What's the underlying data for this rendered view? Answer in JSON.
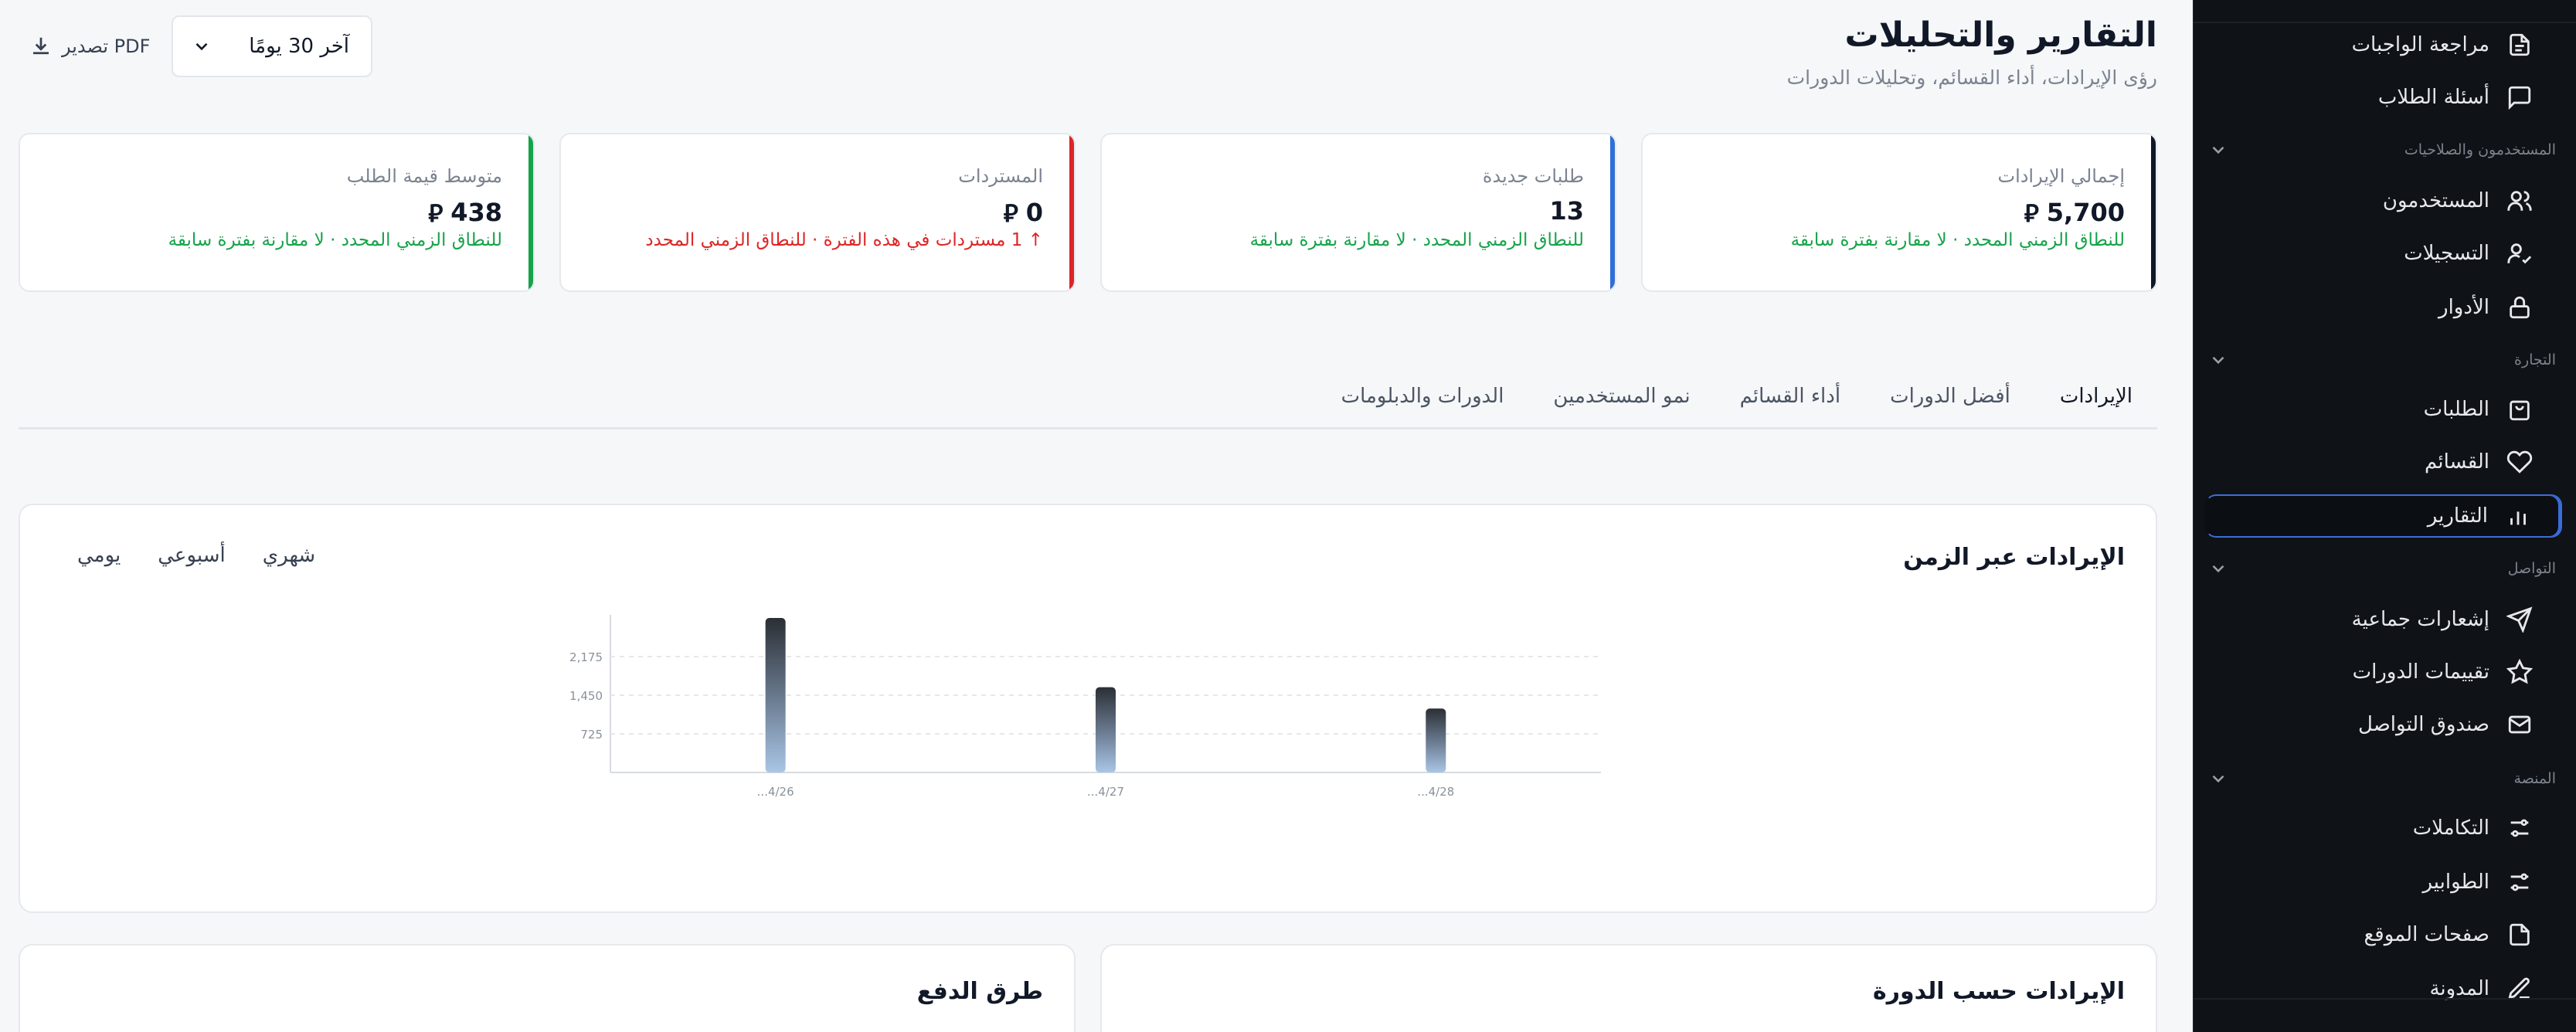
{
  "sidebar": {
    "items": [
      {
        "label": "مراجعة الواجبات",
        "icon": "file-icon"
      },
      {
        "label": "أسئلة الطلاب",
        "icon": "message-icon"
      },
      {
        "label": "المستخدمون",
        "icon": "users-icon"
      },
      {
        "label": "التسجيلات",
        "icon": "user-check-icon"
      },
      {
        "label": "الأدوار",
        "icon": "lock-icon"
      },
      {
        "label": "الطلبات",
        "icon": "shopping-bag-icon"
      },
      {
        "label": "القسائم",
        "icon": "heart-icon"
      },
      {
        "label": "التقارير",
        "icon": "bar-chart-icon",
        "active": true
      },
      {
        "label": "إشعارات جماعية",
        "icon": "send-icon"
      },
      {
        "label": "تقييمات الدورات",
        "icon": "star-icon"
      },
      {
        "label": "صندوق التواصل",
        "icon": "mail-icon"
      },
      {
        "label": "التكاملات",
        "icon": "sliders-icon"
      },
      {
        "label": "الطوابير",
        "icon": "sliders-icon"
      },
      {
        "label": "صفحات الموقع",
        "icon": "file-icon"
      },
      {
        "label": "المدونة",
        "icon": "edit-icon"
      }
    ],
    "sections": [
      {
        "label": "المستخدمون والصلاحيات"
      },
      {
        "label": "التجارة"
      },
      {
        "label": "التواصل"
      },
      {
        "label": "المنصة"
      }
    ]
  },
  "header": {
    "title": "التقارير والتحليلات",
    "subtitle": "رؤى الإيرادات، أداء القسائم، وتحليلات الدورات",
    "range_selected": "آخر 30 يومًا",
    "export_label": "PDF تصدير"
  },
  "currency_symbol": "⃁",
  "kpis": [
    {
      "label": "إجمالي الإيرادات",
      "value": "5,700",
      "note": "للنطاق الزمني المحدد · لا مقارنة بفترة سابقة",
      "accent": "#0f172a",
      "note_color": "green"
    },
    {
      "label": "طلبات جديدة",
      "value": "13",
      "note": "للنطاق الزمني المحدد · لا مقارنة بفترة سابقة",
      "accent": "#2f6fd6",
      "note_color": "green"
    },
    {
      "label": "المستردات",
      "value": "0",
      "note": "↑ 1 مستردات في هذه الفترة · للنطاق الزمني المحدد",
      "accent": "#dc2626",
      "note_color": "red"
    },
    {
      "label": "متوسط قيمة الطلب",
      "value": "438",
      "note": "للنطاق الزمني المحدد · لا مقارنة بفترة سابقة",
      "accent": "#16a34a",
      "note_color": "green"
    }
  ],
  "tabs": [
    {
      "label": "الإيرادات",
      "active": true
    },
    {
      "label": "أفضل الدورات"
    },
    {
      "label": "أداء القسائم"
    },
    {
      "label": "نمو المستخدمين"
    },
    {
      "label": "الدورات والدبلومات"
    }
  ],
  "revenue_panel": {
    "title": "الإيرادات عبر الزمن",
    "granularity": [
      "يومي",
      "أسبوعي",
      "شهري"
    ],
    "granularity_selected": "يومي"
  },
  "chart_data": {
    "type": "bar",
    "categories": [
      "...4/26",
      "...4/27",
      "...4/28"
    ],
    "values": [
      2900,
      1600,
      1200
    ],
    "y_ticks": [
      725,
      1450,
      2175
    ],
    "y_tick_labels": [
      "725",
      "1,450",
      "2,175"
    ],
    "ylim": [
      0,
      2900
    ],
    "grid": true,
    "title": "",
    "xlabel": "",
    "ylabel": ""
  },
  "bottom_panels": {
    "by_course_title": "الإيرادات حسب الدورة",
    "payment_methods_title": "طرق الدفع"
  }
}
